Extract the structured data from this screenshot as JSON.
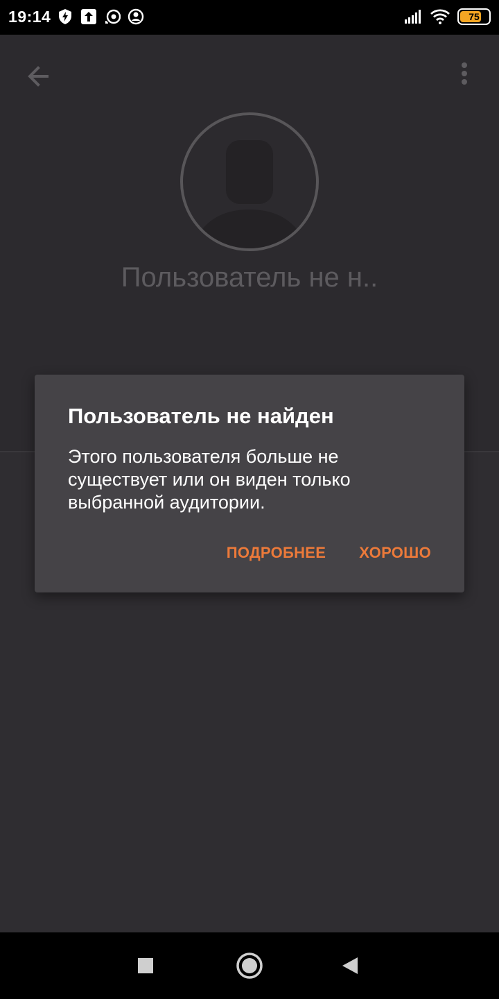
{
  "status_bar": {
    "time": "19:14",
    "battery_level": "75",
    "battery_fraction": 0.75,
    "left_icons": [
      "data-saver-icon",
      "upload-icon",
      "cast-icon",
      "assistant-icon"
    ],
    "right_icons": [
      "signal-icon",
      "wifi-icon",
      "battery-icon"
    ]
  },
  "profile": {
    "name": "Пользователь не н..",
    "avatar_icon": "default-avatar-icon"
  },
  "toolbar": {
    "back_icon": "arrow-back-icon",
    "menu_icon": "more-vert-icon"
  },
  "dialog": {
    "title": "Пользователь не найден",
    "message": "Этого пользователя больше не существует или он виден только выбранной аудитории.",
    "more_label": "ПОДРОБНЕЕ",
    "ok_label": "ХОРОШО"
  },
  "colors": {
    "accent": "#ec7a3a",
    "background": "#2f2d31",
    "dialog": "#454347"
  },
  "nav_bar": {
    "icons": [
      "recents-square-icon",
      "home-circle-icon",
      "back-triangle-icon"
    ]
  }
}
